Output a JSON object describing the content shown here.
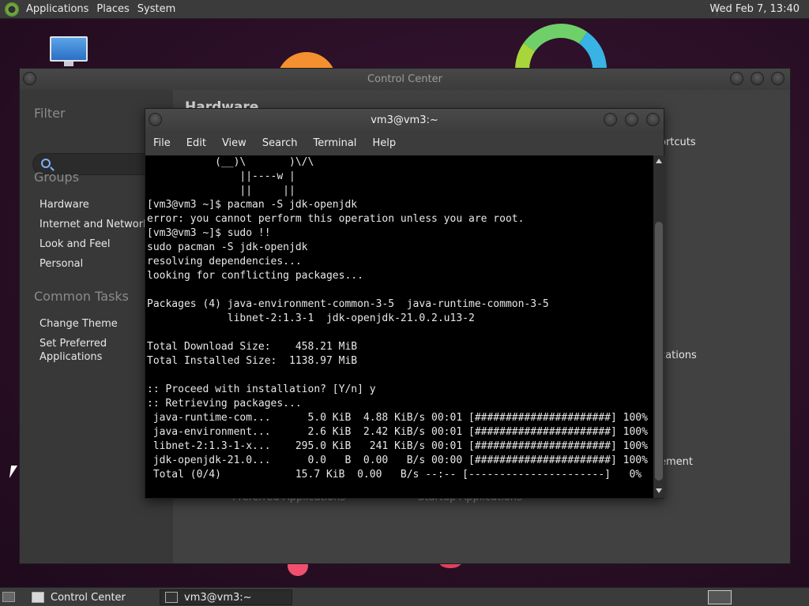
{
  "top_panel": {
    "menus": [
      "Applications",
      "Places",
      "System"
    ],
    "clock": "Wed Feb  7, 13:40"
  },
  "control_center": {
    "title": "Control Center",
    "filter_heading": "Filter",
    "search_placeholder": "",
    "groups_heading": "Groups",
    "groups": [
      "Hardware",
      "Internet and Network",
      "Look and Feel",
      "Personal"
    ],
    "tasks_heading": "Common Tasks",
    "tasks": [
      "Change Theme",
      "Set Preferred Applications"
    ],
    "main_heading": "Hardware",
    "peek": {
      "shortcuts": "ortcuts",
      "applications": "cations",
      "management": "ement",
      "preferred": "Preferred Applications",
      "startup": "Startup Applications"
    }
  },
  "terminal": {
    "title": "vm3@vm3:~",
    "menus": [
      "File",
      "Edit",
      "View",
      "Search",
      "Terminal",
      "Help"
    ],
    "lines": [
      "           (__)\\       )\\/\\",
      "               ||----w |",
      "               ||     ||",
      "[vm3@vm3 ~]$ pacman -S jdk-openjdk",
      "error: you cannot perform this operation unless you are root.",
      "[vm3@vm3 ~]$ sudo !!",
      "sudo pacman -S jdk-openjdk",
      "resolving dependencies...",
      "looking for conflicting packages...",
      "",
      "Packages (4) java-environment-common-3-5  java-runtime-common-3-5",
      "             libnet-2:1.3-1  jdk-openjdk-21.0.2.u13-2",
      "",
      "Total Download Size:    458.21 MiB",
      "Total Installed Size:  1138.97 MiB",
      "",
      ":: Proceed with installation? [Y/n] y",
      ":: Retrieving packages...",
      " java-runtime-com...      5.0 KiB  4.88 KiB/s 00:01 [######################] 100%",
      " java-environment...      2.6 KiB  2.42 KiB/s 00:01 [######################] 100%",
      " libnet-2:1.3-1-x...    295.0 KiB   241 KiB/s 00:01 [######################] 100%",
      " jdk-openjdk-21.0...      0.0   B  0.00   B/s 00:00 [######################] 100%",
      " Total (0/4)            15.7 KiB  0.00   B/s --:-- [----------------------]   0%"
    ]
  },
  "taskbar": {
    "tasks": [
      "Control Center",
      "vm3@vm3:~"
    ]
  },
  "colors": {
    "panel": "#3b3b3b",
    "desktop": "#2a0f26",
    "terminal_bg": "#000000"
  }
}
